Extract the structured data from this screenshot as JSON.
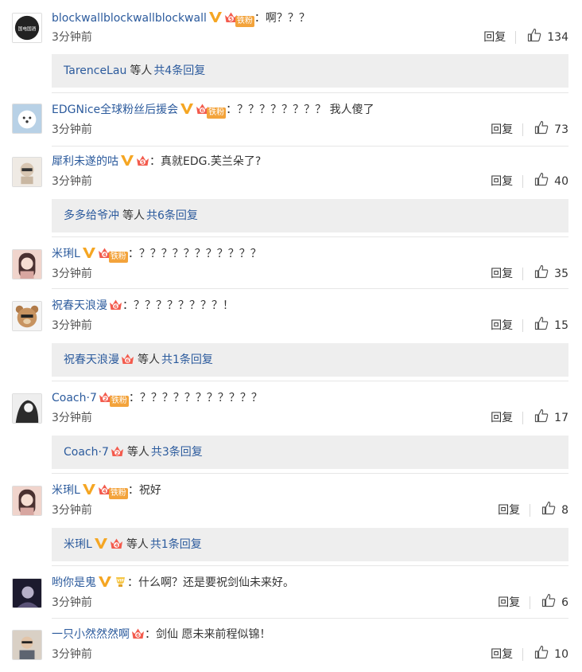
{
  "comments": [
    {
      "user": "blockwallblockwallblockwall",
      "vip": true,
      "level": "5",
      "fan_badge": "铁粉",
      "text": "啊？？？",
      "time": "3分钟前",
      "reply_label": "回复",
      "likes": "134",
      "avatar_icon": "logo-avatar",
      "avatar_text": "国电国酒",
      "avatar_color": "#222",
      "replies": {
        "who": "TarenceLau",
        "who_vip": false,
        "who_crown": false,
        "deng": "等人",
        "count_text": "共4条回复"
      }
    },
    {
      "user": "EDGNice全球粉丝后援会",
      "vip": true,
      "level": "6",
      "fan_badge": "铁粉",
      "text": "？？？？？？？？ 我人傻了",
      "time": "3分钟前",
      "reply_label": "回复",
      "likes": "73",
      "avatar_icon": "dog-avatar",
      "avatar_color": "#a9c3d9"
    },
    {
      "user": "犀利未遂的咕",
      "vip": true,
      "level": "5",
      "fan_badge": "",
      "text": "真就EDG.芙兰朵了?",
      "time": "3分钟前",
      "reply_label": "回复",
      "likes": "40",
      "avatar_icon": "toy-avatar",
      "avatar_color": "#e8e3dc",
      "replies": {
        "who": "多多给爷冲",
        "who_vip": false,
        "who_crown": false,
        "deng": "等人",
        "count_text": "共6条回复"
      }
    },
    {
      "user": "米琍L",
      "vip": true,
      "level": "4",
      "fan_badge": "铁粉",
      "text": "？？？？？？？？？？？",
      "time": "3分钟前",
      "reply_label": "回复",
      "likes": "35",
      "avatar_icon": "girl-avatar",
      "avatar_color": "#d7a6a0"
    },
    {
      "user": "祝春天浪漫",
      "vip": false,
      "level": "6",
      "fan_badge": "",
      "text": "？？？？？？？？！",
      "time": "3分钟前",
      "reply_label": "回复",
      "likes": "15",
      "avatar_icon": "bear-avatar",
      "avatar_color": "#c79360",
      "replies": {
        "who": "祝春天浪漫",
        "who_vip": false,
        "who_crown": true,
        "deng": "等人",
        "count_text": "共1条回复"
      }
    },
    {
      "user": "Coach·7",
      "vip": false,
      "level": "2",
      "fan_badge": "铁粉",
      "text": "？？？？？？？？？？？",
      "time": "3分钟前",
      "reply_label": "回复",
      "likes": "17",
      "avatar_icon": "dark-avatar",
      "avatar_color": "#2b2b2b",
      "replies": {
        "who": "Coach·7",
        "who_vip": false,
        "who_crown": true,
        "deng": "等人",
        "count_text": "共3条回复"
      }
    },
    {
      "user": "米琍L",
      "vip": true,
      "level": "4",
      "fan_badge": "铁粉",
      "text": "祝好",
      "time": "3分钟前",
      "reply_label": "回复",
      "likes": "8",
      "avatar_icon": "girl-avatar",
      "avatar_color": "#d7a6a0",
      "replies": {
        "who": "米琍L",
        "who_vip": true,
        "who_crown": true,
        "deng": "等人",
        "count_text": "共1条回复"
      }
    },
    {
      "user": "哟你是鬼",
      "vip": true,
      "level": "",
      "fan_badge": "",
      "special_badge": true,
      "text": "什么啊？还是要祝剑仙未来好。",
      "time": "3分钟前",
      "reply_label": "回复",
      "likes": "6",
      "avatar_icon": "night-avatar",
      "avatar_color": "#3a3550"
    },
    {
      "user": "一只小然然然啊",
      "vip": false,
      "level": "6",
      "fan_badge": "",
      "text": "剑仙 愿未来前程似锦！",
      "time": "3分钟前",
      "reply_label": "回复",
      "likes": "10",
      "avatar_icon": "man-avatar",
      "avatar_color": "#c8b8a8"
    }
  ],
  "colon": "：",
  "colors": {
    "name": "#2c5b9d",
    "vip": "#f5a623",
    "crown": "#f35b4d",
    "reply_bg": "#eeeeee"
  }
}
